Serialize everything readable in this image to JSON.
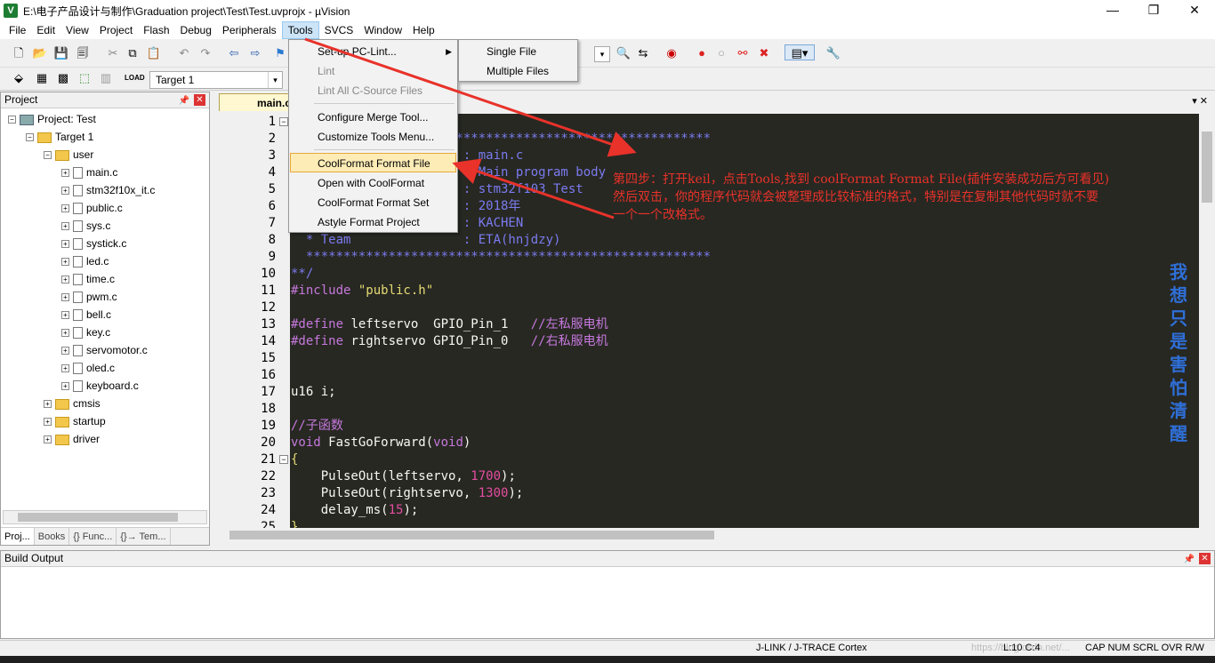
{
  "window": {
    "title": "E:\\电子产品设计与制作\\Graduation project\\Test\\Test.uvprojx - µVision",
    "app_icon": "V",
    "minimize": "—",
    "maximize": "❐",
    "close": "✕"
  },
  "menubar": {
    "items": [
      "File",
      "Edit",
      "View",
      "Project",
      "Flash",
      "Debug",
      "Peripherals",
      "Tools",
      "SVCS",
      "Window",
      "Help"
    ],
    "active": "Tools"
  },
  "toolbar": {
    "target": "Target 1"
  },
  "project_panel": {
    "title": "Project",
    "project": "Project: Test",
    "target": "Target 1",
    "group_user": "user",
    "files": [
      "main.c",
      "stm32f10x_it.c",
      "public.c",
      "sys.c",
      "systick.c",
      "led.c",
      "time.c",
      "pwm.c",
      "bell.c",
      "key.c",
      "servomotor.c",
      "oled.c",
      "keyboard.c"
    ],
    "groups": [
      "cmsis",
      "startup",
      "driver"
    ],
    "tabs": [
      "Proj...",
      "Books",
      "{} Func...",
      "{}→ Tem..."
    ]
  },
  "editor": {
    "tab": "main.c",
    "line_numbers": [
      "1",
      "2",
      "3",
      "4",
      "5",
      "6",
      "7",
      "8",
      "9",
      "10",
      "11",
      "12",
      "13",
      "14",
      "15",
      "16",
      "17",
      "18",
      "19",
      "20",
      "21",
      "22",
      "23",
      "24",
      "25"
    ],
    "lines": {
      "l2": "  ******************************************************",
      "l3": "  * File Name          : main.c",
      "l4": "  * Description        : Main program body",
      "l5": "  * Platform           : stm32f103 Test",
      "l6": "  * Date               : 2018年",
      "l7": "  * Author             : KACHEN",
      "l8": "  * Team               : ETA(hnjdzy)",
      "l9": "  ******************************************************",
      "l10": "**/",
      "l11_a": "#include ",
      "l11_b": "\"public.h\"",
      "l13_a": "#define ",
      "l13_b": "leftservo  GPIO_Pin_1   ",
      "l13_c": "//左私服电机",
      "l14_a": "#define ",
      "l14_b": "rightservo GPIO_Pin_0   ",
      "l14_c": "//右私服电机",
      "l17": "u16 i;",
      "l19": "//子函数",
      "l20_a": "void",
      "l20_b": " FastGoForward(",
      "l20_c": "void",
      "l20_d": ")",
      "l21": "{",
      "l22_a": "    PulseOut(leftservo, ",
      "l22_b": "1700",
      "l22_c": ");",
      "l23_a": "    PulseOut(rightservo, ",
      "l23_b": "1300",
      "l23_c": ");",
      "l24_a": "    delay_ms(",
      "l24_b": "15",
      "l24_c": ");",
      "l25": "}"
    }
  },
  "tools_menu": {
    "items": [
      "Set-up PC-Lint...",
      "Lint",
      "Lint All C-Source Files",
      "Configure Merge Tool...",
      "Customize Tools Menu...",
      "CoolFormat Format File",
      "Open with CoolFormat",
      "CoolFormat Format Set",
      "Astyle Format Project"
    ],
    "highlighted": "CoolFormat Format File"
  },
  "lint_submenu": {
    "items": [
      "Single File",
      "Multiple Files"
    ]
  },
  "annotation": {
    "line1": "第四步：打开keil，点击Tools,找到 coolFormat Format File(插件安装成功后方可看见)",
    "line2": "然后双击，你的程序代码就会被整理成比较标准的格式，特别是在复制其他代码时就不要",
    "line3": "一个一个改格式。",
    "color": "#e8322a"
  },
  "watermark_vertical": "我想只是害怕清醒",
  "build_output": {
    "title": "Build Output"
  },
  "statusbar": {
    "debugger": "J-LINK / J-TRACE Cortex",
    "position": "L:10 C:4",
    "flags": "CAP  NUM  SCRL  OVR  R/W",
    "watermark": "https://blog.csdn.net/..."
  }
}
